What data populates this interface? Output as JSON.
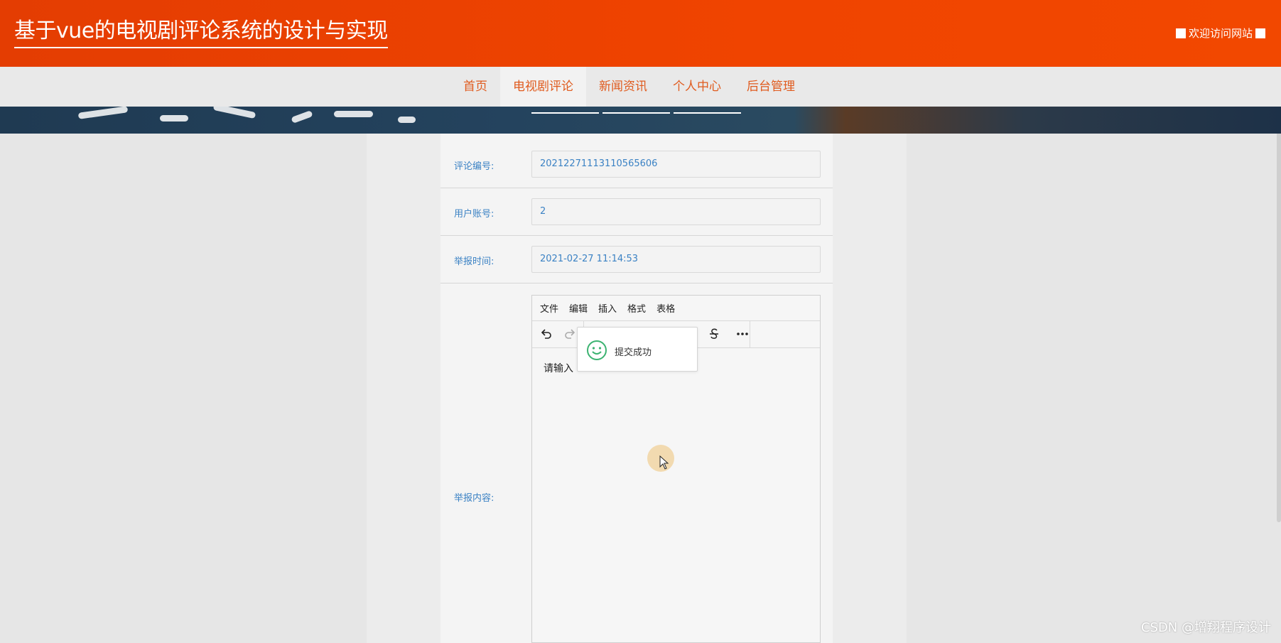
{
  "header": {
    "title": "基于vue的电视剧评论系统的设计与实现",
    "welcome": "欢迎访问网站"
  },
  "nav": {
    "items": [
      {
        "label": "首页"
      },
      {
        "label": "电视剧评论"
      },
      {
        "label": "新闻资讯"
      },
      {
        "label": "个人中心"
      },
      {
        "label": "后台管理"
      }
    ],
    "active": "电视剧评论"
  },
  "form": {
    "comment_id": {
      "label": "评论编号:",
      "value": "20212271113110565606"
    },
    "user_account": {
      "label": "用户账号:",
      "value": "2"
    },
    "report_time": {
      "label": "举报时间:",
      "value": "2021-02-27 11:14:53"
    },
    "report_content": {
      "label": "举报内容:"
    }
  },
  "editor": {
    "menus": [
      "文件",
      "编辑",
      "插入",
      "格式",
      "表格"
    ],
    "toolbar_icons": [
      "undo-icon",
      "redo-icon",
      "underline-icon",
      "strikethrough-icon",
      "more-icon"
    ],
    "placeholder_visible": "请输入"
  },
  "toast": {
    "message": "提交成功",
    "icon": "smile-icon",
    "color": "#3cb371"
  },
  "watermark": "CSDN @增翔程序设计",
  "colors": {
    "header": "#ee4200",
    "nav_text": "#e05b1e",
    "label_text": "#3b82c4"
  }
}
